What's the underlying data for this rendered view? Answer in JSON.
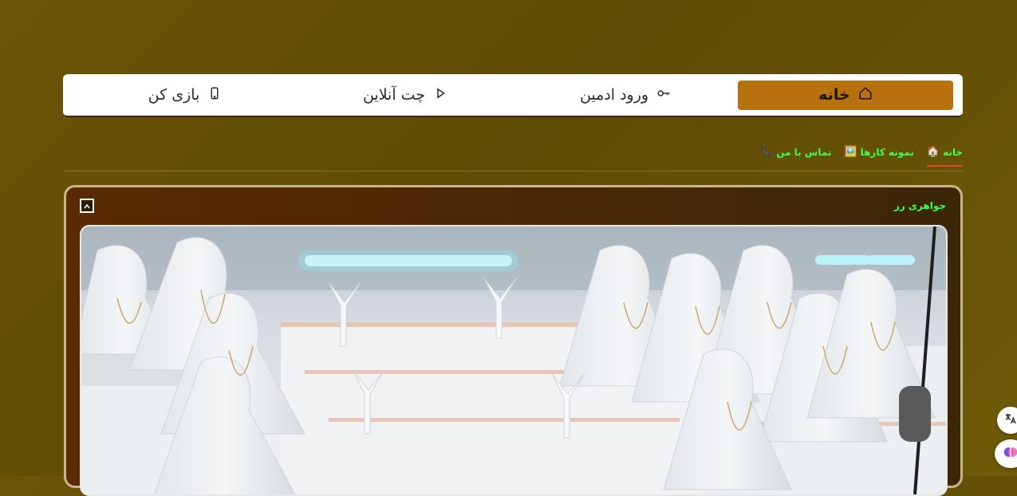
{
  "nav": {
    "items": [
      {
        "label": "خانه",
        "icon": "home-icon",
        "active": true
      },
      {
        "label": "ورود ادمین",
        "icon": "key-icon",
        "active": false
      },
      {
        "label": "چت آنلاین",
        "icon": "play-icon",
        "active": false
      },
      {
        "label": "بازی کن",
        "icon": "phone-icon",
        "active": false
      }
    ]
  },
  "tabs": {
    "items": [
      {
        "label": "خانه",
        "emoji": "🏠"
      },
      {
        "label": "نمونه کارها",
        "emoji": "🖼️"
      },
      {
        "label": "تماس با من",
        "emoji": "📞"
      }
    ]
  },
  "card": {
    "title": "جواهری رز",
    "image": "jewelry-display-photo"
  },
  "colors": {
    "background": "#6b5406",
    "nav_active": "#b7710f",
    "tab_text": "#3cff4a",
    "tab_underline": "#e0442c"
  }
}
